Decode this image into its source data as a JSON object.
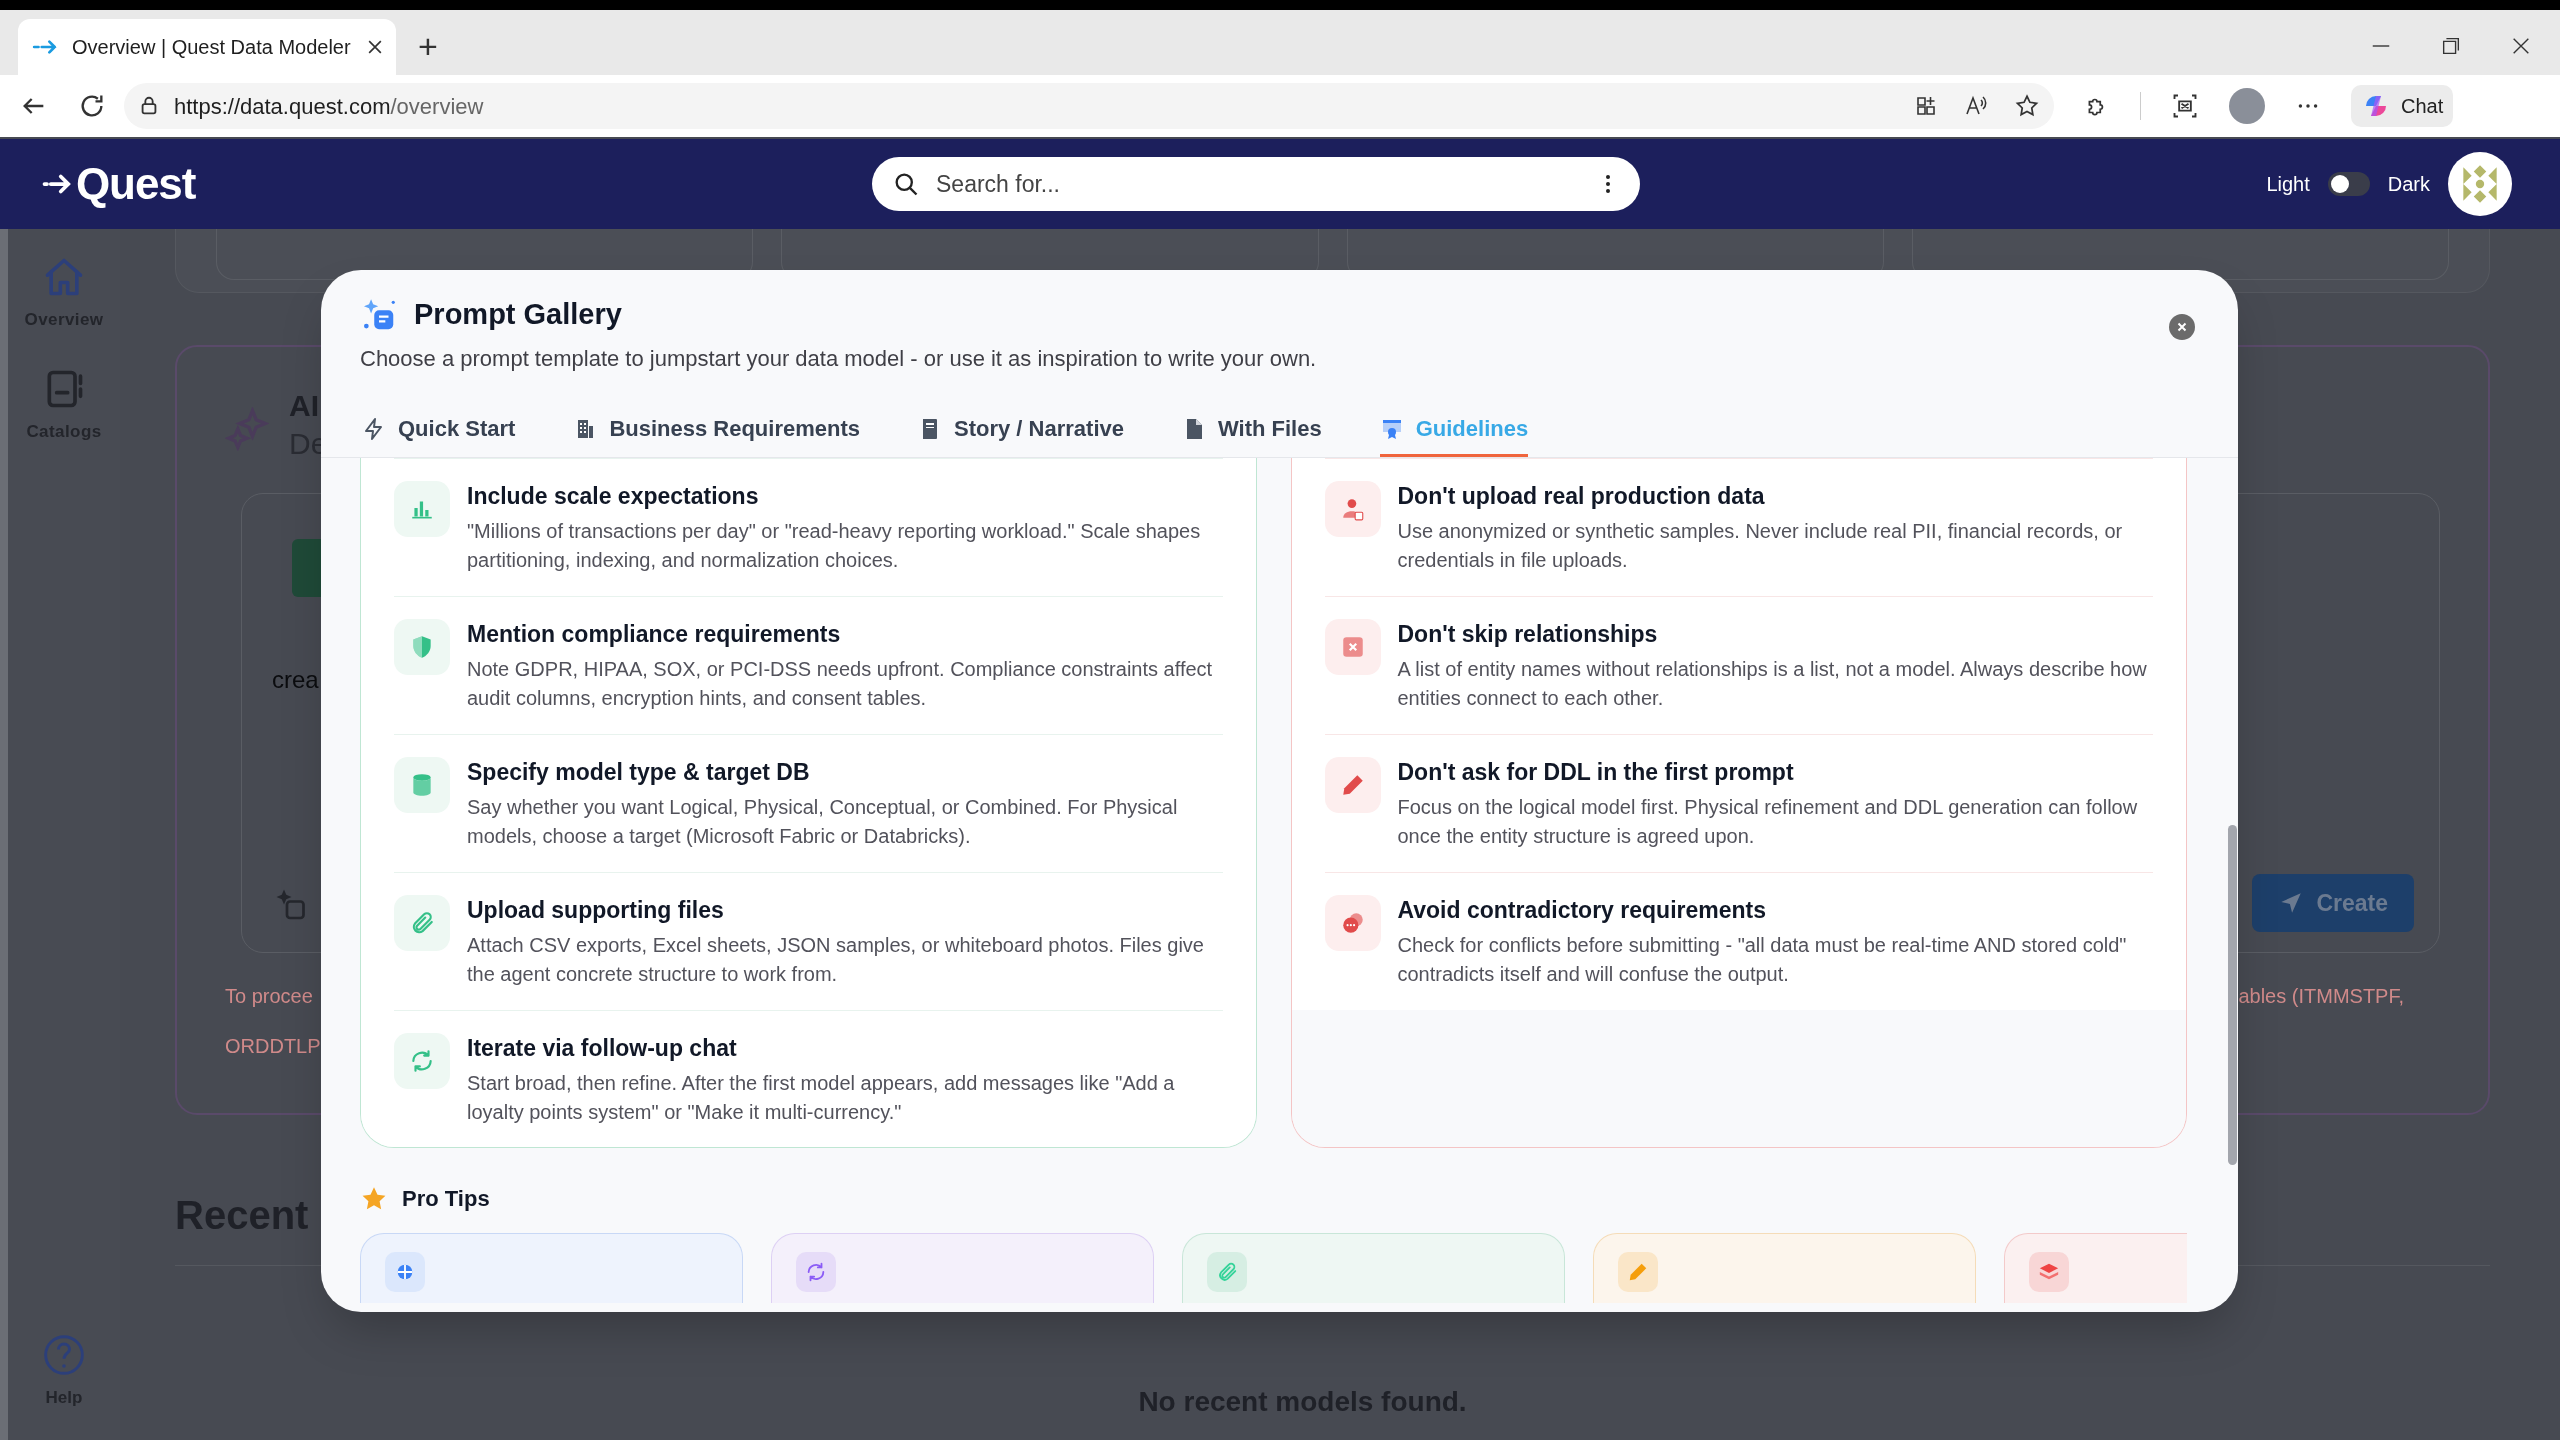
{
  "browser": {
    "tab_title": "Overview | Quest Data Modeler",
    "new_tab": "+",
    "url_host": "https://data.quest.com",
    "url_path": "/overview",
    "chat_label": "Chat"
  },
  "header": {
    "logo": "Quest",
    "search_placeholder": "Search for...",
    "light_label": "Light",
    "dark_label": "Dark",
    "dark_mode": false
  },
  "sidebar": {
    "items": [
      {
        "label": "Overview",
        "kind": "home",
        "selected": true
      },
      {
        "label": "Catalogs",
        "kind": "catalog",
        "selected": false
      }
    ],
    "help": "Help"
  },
  "background": {
    "card_title": "AI",
    "card_subtitle": "De",
    "prompt_text": "crea",
    "notice_line_1": "To procee",
    "notice_tail": "ables (ITMMSTPF,",
    "notice_line_2": "ORDDTLP",
    "create_button": "Create",
    "recent_heading": "Recent",
    "empty_message": "No recent models found."
  },
  "modal": {
    "title": "Prompt Gallery",
    "subtitle": "Choose a prompt template to jumpstart your data model - or use it as inspiration to write your own.",
    "tabs": [
      {
        "label": "Quick Start",
        "kind": "bolt",
        "selected": false
      },
      {
        "label": "Business Requirements",
        "kind": "building",
        "selected": false
      },
      {
        "label": "Story / Narrative",
        "kind": "book",
        "selected": false
      },
      {
        "label": "With Files",
        "kind": "file",
        "selected": false
      },
      {
        "label": "Guidelines",
        "kind": "badge",
        "selected": true
      }
    ],
    "do_items": [
      {
        "kind": "chart",
        "title": "Include scale expectations",
        "description": "\"Millions of transactions per day\" or \"read-heavy reporting workload.\" Scale shapes partitioning, indexing, and normalization choices."
      },
      {
        "kind": "shield",
        "title": "Mention compliance requirements",
        "description": "Note GDPR, HIPAA, SOX, or PCI-DSS needs upfront. Compliance constraints affect audit columns, encryption hints, and consent tables."
      },
      {
        "kind": "database",
        "title": "Specify model type & target DB",
        "description": "Say whether you want Logical, Physical, Conceptual, or Combined. For Physical models, choose a target (Microsoft Fabric or Databricks)."
      },
      {
        "kind": "paperclip",
        "title": "Upload supporting files",
        "description": "Attach CSV exports, Excel sheets, JSON samples, or whiteboard photos. Files give the agent concrete structure to work from."
      },
      {
        "kind": "refresh",
        "title": "Iterate via follow-up chat",
        "description": "Start broad, then refine. After the first model appears, add messages like \"Add a loyalty points system\" or \"Make it multi-currency.\""
      }
    ],
    "dont_items": [
      {
        "kind": "user-x",
        "title": "Don't upload real production data",
        "description": "Use anonymized or synthetic samples. Never include real PII, financial records, or credentials in file uploads."
      },
      {
        "kind": "square-x",
        "title": "Don't skip relationships",
        "description": "A list of entity names without relationships is a list, not a model. Always describe how entities connect to each other."
      },
      {
        "kind": "pencil",
        "title": "Don't ask for DDL in the first prompt",
        "description": "Focus on the logical model first. Physical refinement and DDL generation can follow once the entity structure is agreed upon."
      },
      {
        "kind": "chat",
        "title": "Avoid contradictory requirements",
        "description": "Check for conflicts before submitting - \"all data must be real-time AND stored cold\" contradicts itself and will confuse the output."
      }
    ],
    "pro_tips": {
      "title": "Pro Tips",
      "cards": [
        {
          "kind": "target",
          "color": "#3b82f6"
        },
        {
          "kind": "refresh",
          "color": "#8b5cf6"
        },
        {
          "kind": "paperclip",
          "color": "#34d399"
        },
        {
          "kind": "pencil",
          "color": "#f59e0b"
        },
        {
          "kind": "layers",
          "color": "#ef4444"
        }
      ]
    }
  }
}
